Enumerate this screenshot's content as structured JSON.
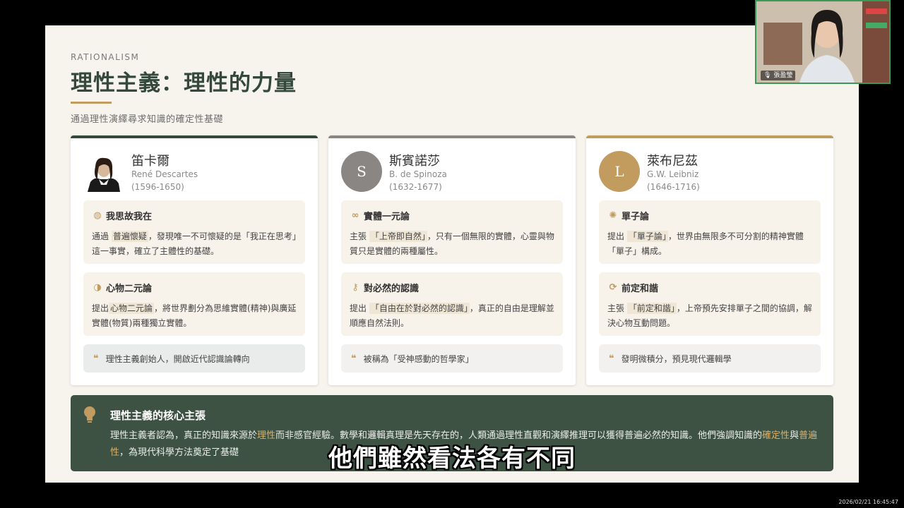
{
  "slide": {
    "eyebrow": "RATIONALISM",
    "title": "理性主義：理性的力量",
    "subtitle": "通過理性演繹尋求知識的確定性基礎"
  },
  "cards": [
    {
      "name": "笛卡爾",
      "en": "René Descartes",
      "dates": "(1596-1650)",
      "avatar_letter": "",
      "boxes": [
        {
          "icon": "brain-icon",
          "head": "我思故我在",
          "pre": "通過",
          "hl": "普遍懷疑",
          "post": "，發現唯一不可懷疑的是「我正在思考」這一事實，確立了主體性的基礎。"
        },
        {
          "icon": "yin-yang-icon",
          "head": "心物二元論",
          "pre": "提出",
          "hl": "心物二元論",
          "post": "，將世界劃分為思維實體(精神)與廣延實體(物質)兩種獨立實體。"
        }
      ],
      "quote": "理性主義創始人，開啟近代認識論轉向"
    },
    {
      "name": "斯賓諾莎",
      "en": "B. de Spinoza",
      "dates": "(1632-1677)",
      "avatar_letter": "S",
      "boxes": [
        {
          "icon": "infinity-icon",
          "head": "實體一元論",
          "pre": "主張",
          "hl": "「上帝即自然」",
          "post": "，只有一個無限的實體，心靈與物質只是實體的兩種屬性。"
        },
        {
          "icon": "key-icon",
          "head": "對必然的認識",
          "pre": "提出",
          "hl": "「自由在於對必然的認識」",
          "post": "，真正的自由是理解並順應自然法則。"
        }
      ],
      "quote": "被稱為「受神感動的哲學家」"
    },
    {
      "name": "萊布尼茲",
      "en": "G.W. Leibniz",
      "dates": "(1646-1716)",
      "avatar_letter": "L",
      "boxes": [
        {
          "icon": "atom-icon",
          "head": "單子論",
          "pre": "提出",
          "hl": "「單子論」",
          "post": "，世界由無限多不可分割的精神實體「單子」構成。"
        },
        {
          "icon": "sync-icon",
          "head": "前定和諧",
          "pre": "主張",
          "hl": "「前定和諧」",
          "post": "，上帝預先安排單子之間的協調，解決心物互動問題。"
        }
      ],
      "quote": "發明微積分，預見現代邏輯學"
    }
  ],
  "core": {
    "title": "理性主義的核心主張",
    "p1": "理性主義者認為，真正的知識來源於",
    "g1": "理性",
    "p2": "而非感官經驗。數學和邏輯真理是先天存在的，人類通過理性直觀和演繹推理可以獲得普遍必然的知識。他們強調知識的",
    "g2": "確定性",
    "p3": "與",
    "g3": "普遍性",
    "p4": "，為現代科學方法奠定了基礎"
  },
  "caption": "他們雖然看法各有不同",
  "webcam": {
    "label": "張盈瑩"
  },
  "timestamp": "2026/02/21 16:45:47",
  "colors": {
    "green": "#34483c",
    "gold": "#c29b5f",
    "gray": "#8a8683"
  }
}
